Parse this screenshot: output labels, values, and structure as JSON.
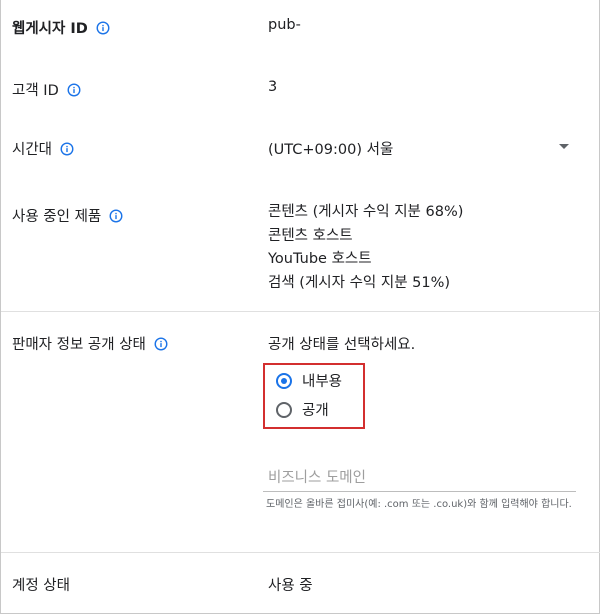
{
  "publisher": {
    "label": "웹게시자 ID",
    "value": "pub-"
  },
  "customer": {
    "label": "고객 ID",
    "value": "3"
  },
  "timezone": {
    "label": "시간대",
    "value": "(UTC+09:00) 서울"
  },
  "products": {
    "label": "사용 중인 제품",
    "items": [
      "콘텐츠 (게시자 수익 지분 68%)",
      "콘텐츠 호스트",
      "YouTube 호스트",
      "검색 (게시자 수익 지분 51%)"
    ]
  },
  "seller": {
    "label": "판매자 정보 공개 상태",
    "prompt": "공개 상태를 선택하세요.",
    "options": [
      {
        "label": "내부용",
        "selected": true
      },
      {
        "label": "공개",
        "selected": false
      }
    ],
    "domain_placeholder": "비즈니스 도메인",
    "domain_hint": "도메인은 올바른 접미사(예: .com 또는 .co.uk)와 함께 입력해야 합니다."
  },
  "account_status": {
    "label": "계정 상태",
    "value": "사용 중"
  },
  "colors": {
    "accent": "#1a73e8",
    "highlight_border": "#d32f2f",
    "icon": "#1a73e8"
  }
}
